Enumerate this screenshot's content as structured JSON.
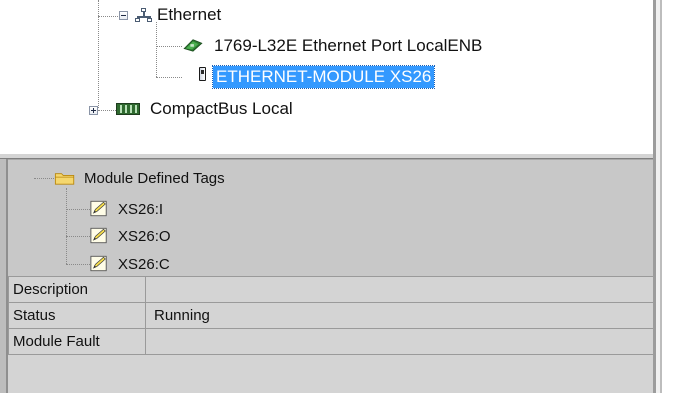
{
  "tree": {
    "ethernet_label": "Ethernet",
    "port_label": "1769-L32E Ethernet Port LocalENB",
    "module_label": "ETHERNET-MODULE XS26",
    "compactbus_label": "CompactBus Local"
  },
  "properties": {
    "tags_folder_label": "Module Defined Tags",
    "tags": [
      "XS26:I",
      "XS26:O",
      "XS26:C"
    ],
    "rows": [
      {
        "key": "Description",
        "value": ""
      },
      {
        "key": "Status",
        "value": "Running"
      },
      {
        "key": "Module Fault",
        "value": ""
      }
    ]
  },
  "colors": {
    "selection": "#3399ff",
    "pane_background": "#d4d4d4"
  },
  "icons": {
    "ethernet": "network-icon",
    "port": "ethernet-port-icon",
    "module": "module-icon",
    "compactbus": "backplane-icon",
    "folder": "folder-icon",
    "tag": "tag-pencil-icon"
  }
}
